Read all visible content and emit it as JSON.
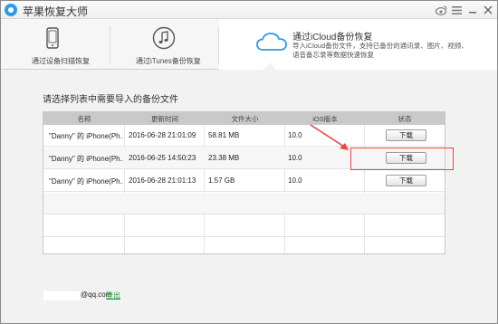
{
  "app": {
    "title": "苹果恢复大师"
  },
  "modes": [
    {
      "label": "通过设备扫描恢复",
      "icon": "phone-icon"
    },
    {
      "label": "通过iTunes备份恢复",
      "icon": "music-note-icon"
    },
    {
      "label": "通过iCloud备份恢复",
      "icon": "cloud-icon",
      "description": "导入iCloud备份文件，支持已备份的通讯录、图片、视频、语音备忘录等数据快速恢复"
    }
  ],
  "main": {
    "prompt": "请选择列表中需要导入的备份文件",
    "columns": [
      "名称",
      "更新时间",
      "文件大小",
      "iOS版本",
      "状态"
    ],
    "rows": [
      {
        "name": "\"Danny\" 的 iPhone(Ph...",
        "updated": "2016-06-28 21:01:09",
        "size": "58.81 MB",
        "ios": "10.0",
        "action": "下载"
      },
      {
        "name": "\"Danny\" 的 iPhone(Ph...",
        "updated": "2016-06-25 14:50:23",
        "size": "23.38 MB",
        "ios": "10.0",
        "action": "下载"
      },
      {
        "name": "\"Danny\" 的 iPhone(Ph...",
        "updated": "2016-06-28 21:01:13",
        "size": "1.57 GB",
        "ios": "10.0",
        "action": "下载"
      }
    ]
  },
  "footer": {
    "email": "@qq.com",
    "login": "登出"
  },
  "colors": {
    "accent": "#2b9ae8",
    "highlight": "#e44444",
    "login_link": "#1d9b3a"
  }
}
